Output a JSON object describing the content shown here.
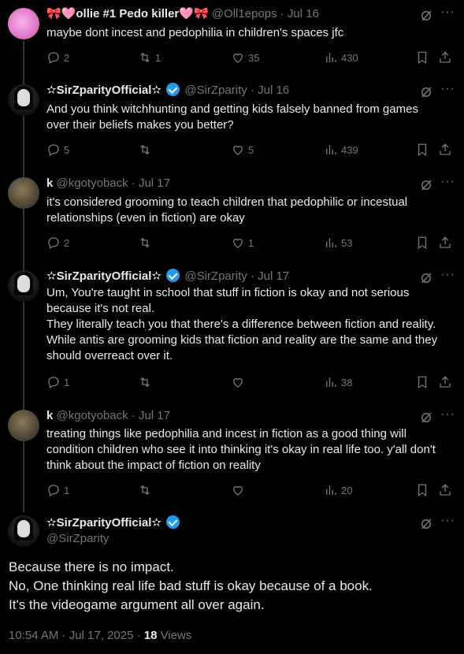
{
  "replies": [
    {
      "name_prefix": "🎀🩷",
      "name": "ollie #1 Pedo killer",
      "name_suffix": "🩷🎀",
      "handle": "@Oll1epops",
      "date": "Jul 16",
      "text": "maybe dont incest and pedophilia in children's spaces jfc",
      "replies": "2",
      "reposts": "1",
      "likes": "35",
      "views": "430"
    },
    {
      "name": "✫SirZparityOfficial✫",
      "handle": "@SirZparity",
      "date": "Jul 16",
      "text": "And you think witchhunting and getting kids falsely banned from games\nover their beliefs makes you better?",
      "replies": "5",
      "reposts": "",
      "likes": "5",
      "views": "439"
    },
    {
      "name": "k",
      "handle": "@kgotyoback",
      "date": "Jul 17",
      "text": "it's considered grooming to teach children that pedophilic or incestual\nrelationships (even in fiction) are okay",
      "replies": "2",
      "reposts": "",
      "likes": "1",
      "views": "53"
    },
    {
      "name": "✫SirZparityOfficial✫",
      "handle": "@SirZparity",
      "date": "Jul 17",
      "text": "Um, You're taught in school that stuff in fiction is okay and not serious\nbecause it's not real.\nThey literally teach you that there's a difference between fiction and reality.\nWhile antis are grooming kids that fiction and reality are the same and they\nshould overreact over it.",
      "replies": "1",
      "reposts": "",
      "likes": "",
      "views": "38"
    },
    {
      "name": "k",
      "handle": "@kgotyoback",
      "date": "Jul 17",
      "text": "treating things like pedophilia and incest in fiction as a good thing will\ncondition children who see it into thinking it's okay in real life too. y'all don't\nthink about the impact of fiction on reality",
      "replies": "1",
      "reposts": "",
      "likes": "",
      "views": "20"
    }
  ],
  "main_post": {
    "name": "✫SirZparityOfficial✫",
    "handle": "@SirZparity",
    "text": "Because there is no impact.\nNo, One thinking real life bad stuff is okay because of a book.\nIt's the videogame argument all over again.",
    "timestamp": "10:54 AM · Jul 17, 2025",
    "separator": " · ",
    "views_count": "18",
    "views_label": " Views"
  },
  "separator": "·",
  "more_glyph": "···",
  "colors": {
    "background": "#000000",
    "text": "#e7e9ea",
    "muted": "#71767b",
    "verified": "#1d9bf0",
    "thread_line": "#333639"
  },
  "icons": [
    "reply-icon",
    "repost-icon",
    "like-icon",
    "views-icon",
    "bookmark-icon",
    "share-icon",
    "grok-icon",
    "more-icon",
    "verified-icon"
  ]
}
